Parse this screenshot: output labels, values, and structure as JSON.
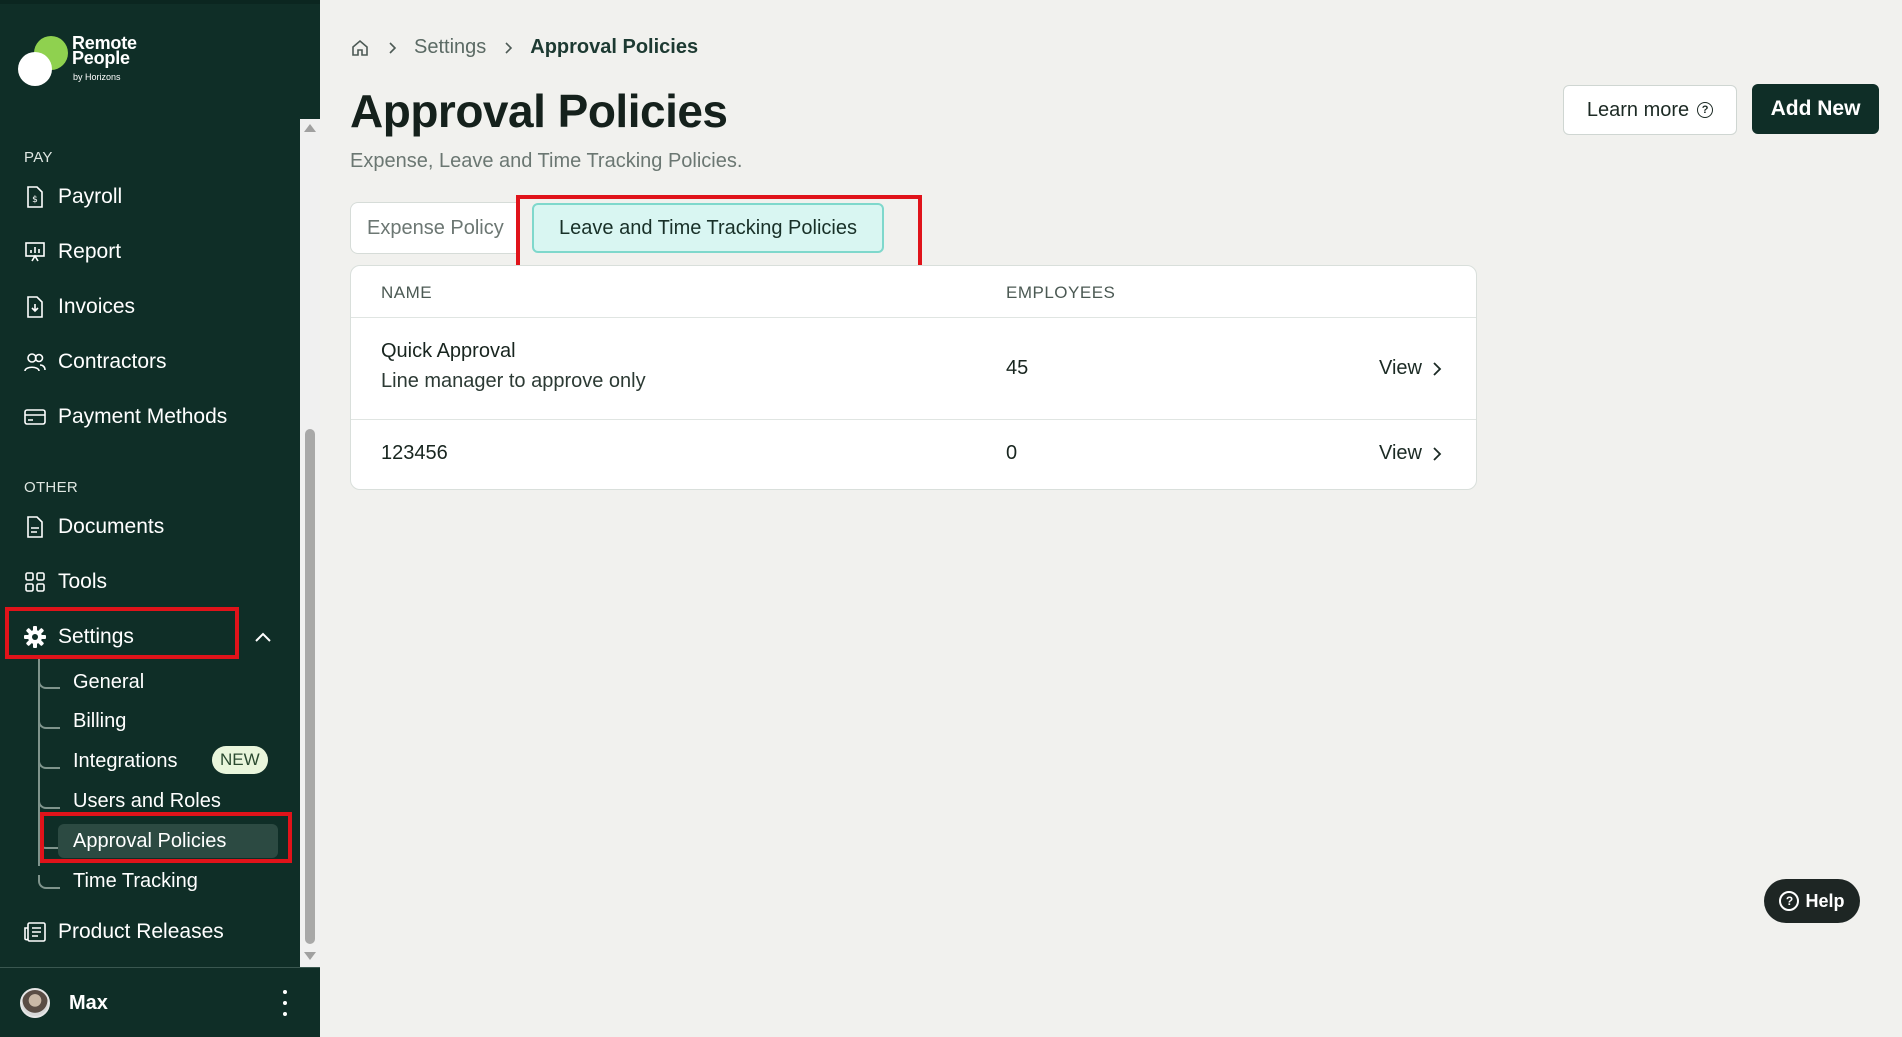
{
  "brand": {
    "name_line1": "Remote",
    "name_line2": "People",
    "by": "by Horizons"
  },
  "sidebar": {
    "pay_label": "PAY",
    "pay_items": [
      {
        "label": "Payroll",
        "icon": "payroll-icon"
      },
      {
        "label": "Report",
        "icon": "report-icon"
      },
      {
        "label": "Invoices",
        "icon": "invoice-icon"
      },
      {
        "label": "Contractors",
        "icon": "contractors-icon"
      },
      {
        "label": "Payment Methods",
        "icon": "card-icon"
      }
    ],
    "other_label": "OTHER",
    "other_items": [
      {
        "label": "Documents",
        "icon": "document-icon"
      },
      {
        "label": "Tools",
        "icon": "grid-icon"
      },
      {
        "label": "Settings",
        "icon": "gear-icon"
      }
    ],
    "settings_sub": [
      {
        "label": "General"
      },
      {
        "label": "Billing"
      },
      {
        "label": "Integrations",
        "badge": "NEW"
      },
      {
        "label": "Users and Roles"
      },
      {
        "label": "Approval Policies",
        "active": true
      },
      {
        "label": "Time Tracking"
      }
    ],
    "product_releases": "Product Releases",
    "user": {
      "name": "Max"
    }
  },
  "breadcrumb": {
    "home_icon": "home-icon",
    "settings": "Settings",
    "current": "Approval Policies"
  },
  "header": {
    "title": "Approval Policies",
    "subtitle": "Expense, Leave and Time Tracking Policies.",
    "learn_more": "Learn more",
    "add_new": "Add New"
  },
  "tabs": [
    {
      "label": "Expense Policy",
      "active": false
    },
    {
      "label": "Leave and Time Tracking Policies",
      "active": true
    }
  ],
  "table": {
    "columns": [
      "NAME",
      "EMPLOYEES"
    ],
    "rows": [
      {
        "name": "Quick Approval",
        "description": "Line manager to approve only",
        "employees": "45",
        "action": "View"
      },
      {
        "name": "123456",
        "description": "",
        "employees": "0",
        "action": "View"
      }
    ]
  },
  "help": {
    "label": "Help"
  },
  "colors": {
    "sidebar_bg": "#0f2e27",
    "accent_green": "#8fd14f",
    "active_tab_bg": "#d9f6f2",
    "highlight_red": "#e0131a"
  }
}
